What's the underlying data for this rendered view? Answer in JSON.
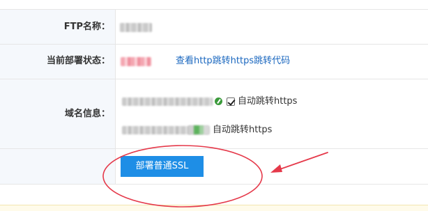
{
  "form": {
    "ftp_name_label": "FTP名称：",
    "deploy_status_label": "当前部署状态：",
    "domain_info_label": "域名信息：",
    "http_redirect_link": "查看http跳转https跳转代码",
    "domains": [
      {
        "auto_redirect_label": "自动跳转https",
        "checked": true
      },
      {
        "auto_redirect_label": "自动跳转https",
        "checked": false
      }
    ],
    "deploy_ssl_button": "部署普通SSL"
  },
  "colors": {
    "button_bg": "#1e8ee6",
    "link": "#1a67bf",
    "annotation_red": "#e5394a",
    "label_column_bg": "#f5f8fc"
  }
}
